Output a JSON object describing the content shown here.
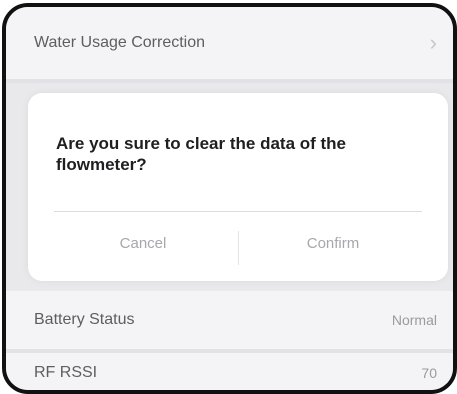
{
  "list": {
    "water_usage_correction": "Water Usage Correction",
    "chevron": "›",
    "battery_status_label": "Battery Status",
    "battery_status_value": "Normal",
    "rf_rssi_label": "RF RSSI",
    "rf_rssi_value": "70"
  },
  "dialog": {
    "message": "Are you sure to clear the data of the flowmeter?",
    "cancel_label": "Cancel",
    "confirm_label": "Confirm"
  }
}
